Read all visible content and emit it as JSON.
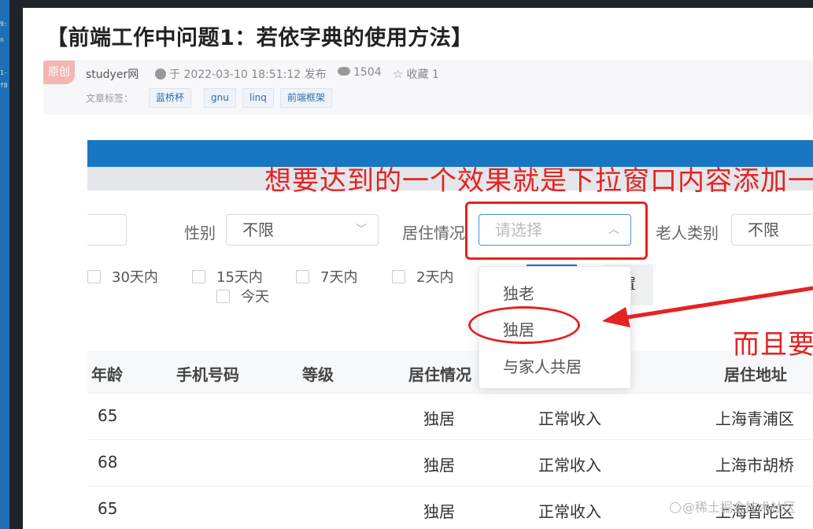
{
  "sidebar_fragment": {
    "lines": [
      "9:",
      "n",
      "1-",
      "f8"
    ]
  },
  "article": {
    "title": "【前端工作中问题1：若依字典的使用方法】",
    "badge": "原创",
    "author": "studyer网",
    "published": "于 2022-03-10 18:51:12 发布",
    "views": "1504",
    "favorites": "收藏 1",
    "tags_label": "文章标签：",
    "tags": [
      "蓝桥杯",
      "gnu",
      "linq",
      "前端框架"
    ]
  },
  "screenshot": {
    "annotation_top": "想要达到的一个效果就是下拉窗口内容添加一",
    "annotation_right": "而且要",
    "filters": {
      "gender_label": "性别",
      "gender_value": "不限",
      "residence_label": "居住情况",
      "residence_placeholder": "请选择",
      "elder_type_label": "老人类别",
      "elder_type_value": "不限"
    },
    "checkboxes": [
      "30天内",
      "15天内",
      "7天内",
      "2天内",
      "今天"
    ],
    "reset_button_fragment": "置",
    "dropdown_options": [
      "独老",
      "独居",
      "与家人共居"
    ],
    "table": {
      "headers": [
        "年龄",
        "手机号码",
        "等级",
        "居住情况",
        "居住地址"
      ],
      "rows": [
        {
          "age": "65",
          "residence": "独居",
          "income": "正常收入",
          "address": "上海青浦区"
        },
        {
          "age": "68",
          "residence": "独居",
          "income": "正常收入",
          "address": "上海市胡桥"
        },
        {
          "age": "65",
          "residence": "独居",
          "income": "正常收入",
          "address": "上海普陀区"
        }
      ]
    }
  },
  "watermark": "@稀土掘金技术社区",
  "colors": {
    "annotation_red": "#e52222",
    "header_blue": "#1976c2",
    "link_blue": "#2f6ba5"
  }
}
